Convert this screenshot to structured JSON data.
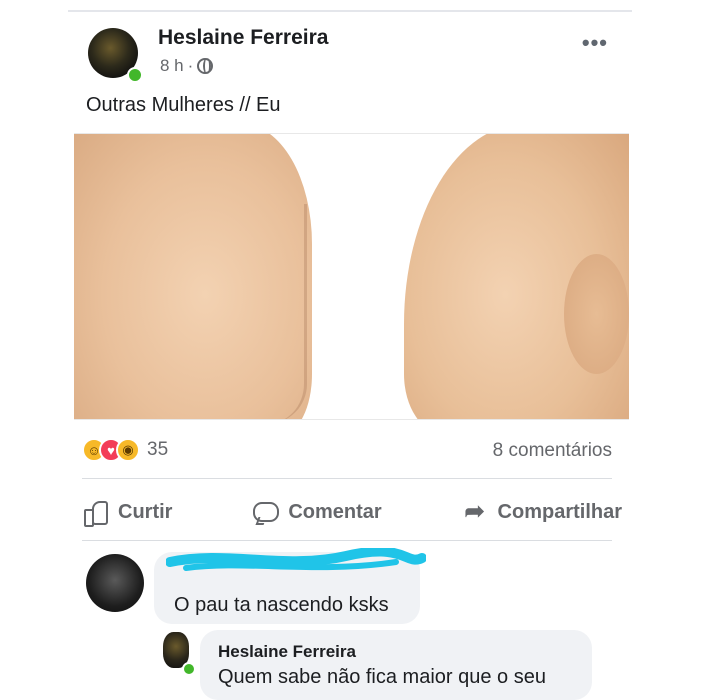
{
  "post": {
    "author": "Heslaine Ferreira",
    "time": "8 h",
    "separator": "·",
    "caption": "Outras Mulheres // Eu",
    "more_icon": "more-options-icon",
    "privacy_icon": "globe-icon"
  },
  "stats": {
    "reactions": [
      "haha",
      "love",
      "wow"
    ],
    "reaction_count": "35",
    "comments_count": "8 comentários"
  },
  "actions": {
    "like": "Curtir",
    "comment": "Comentar",
    "share": "Compartilhar"
  },
  "comments": [
    {
      "name": "",
      "text": "O pau ta nascendo ksks"
    },
    {
      "name": "Heslaine Ferreira",
      "text": "Quem sabe não fica maior que o seu"
    }
  ],
  "colors": {
    "text_primary": "#1c1e21",
    "text_secondary": "#65676b",
    "online": "#42b72a",
    "bubble": "#f0f2f5",
    "scribble": "#20c4e8"
  }
}
